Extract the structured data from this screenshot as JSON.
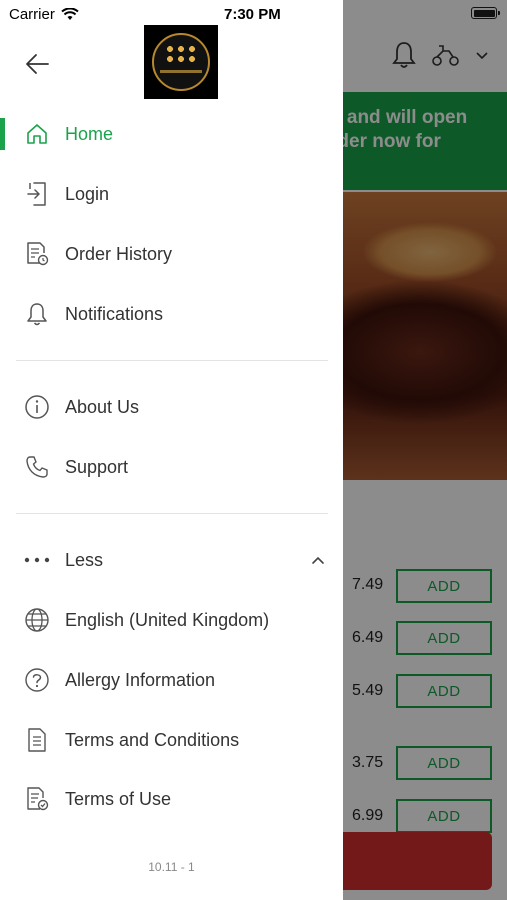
{
  "status_bar": {
    "carrier": "Carrier",
    "time": "7:30 PM"
  },
  "background": {
    "banner_text_line1": "d and will open",
    "banner_text_line2": "rder now for",
    "items": [
      {
        "price": "7.49",
        "button": "ADD"
      },
      {
        "price": "6.49",
        "button": "ADD"
      },
      {
        "price": "5.49",
        "button": "ADD"
      },
      {
        "price": "3.75",
        "button": "ADD"
      },
      {
        "price": "6.99",
        "button": "ADD"
      }
    ]
  },
  "drawer": {
    "menu": [
      {
        "label": "Home",
        "icon": "home-icon",
        "active": true
      },
      {
        "label": "Login",
        "icon": "login-icon"
      },
      {
        "label": "Order History",
        "icon": "order-history-icon"
      },
      {
        "label": "Notifications",
        "icon": "bell-icon"
      }
    ],
    "info": [
      {
        "label": "About Us",
        "icon": "info-icon"
      },
      {
        "label": "Support",
        "icon": "phone-icon"
      }
    ],
    "more": {
      "label": "Less",
      "items": [
        {
          "label": "English (United Kingdom)",
          "icon": "globe-icon"
        },
        {
          "label": "Allergy Information",
          "icon": "question-icon"
        },
        {
          "label": "Terms and Conditions",
          "icon": "document-icon"
        },
        {
          "label": "Terms of Use",
          "icon": "document-check-icon"
        }
      ]
    },
    "version": "10.11 - 1"
  },
  "colors": {
    "accent": "#1aa34a",
    "checkout": "#d32f2f"
  }
}
